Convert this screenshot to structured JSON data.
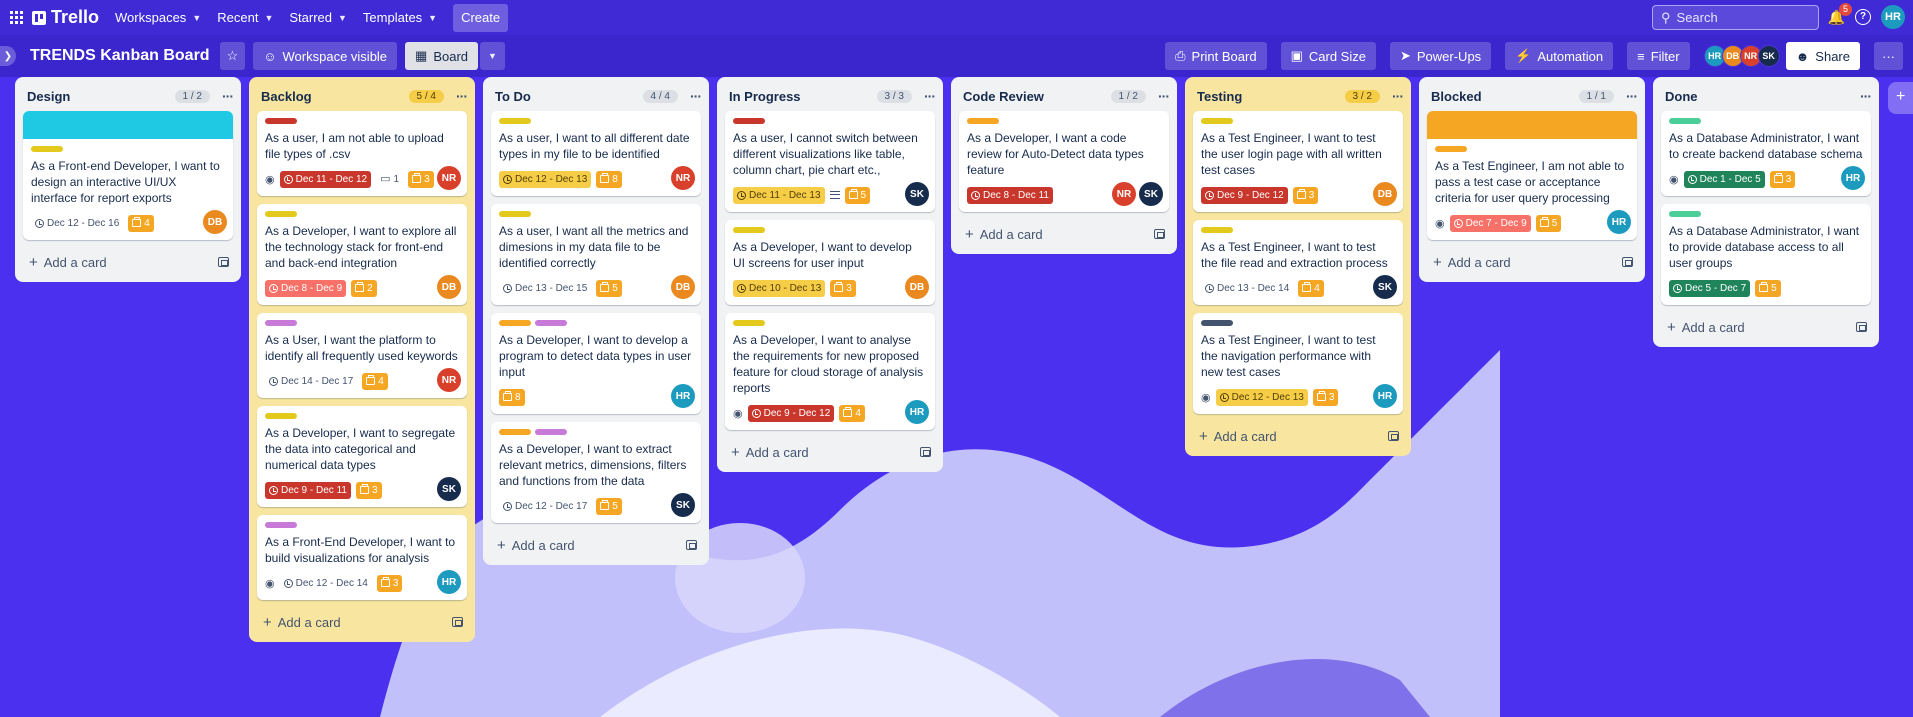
{
  "topbar": {
    "app_name": "Trello",
    "menus": [
      "Workspaces",
      "Recent",
      "Starred",
      "Templates"
    ],
    "create_label": "Create",
    "search_placeholder": "Search",
    "notifications_count": "5",
    "user_initials": "HR"
  },
  "board": {
    "title": "TRENDS Kanban Board",
    "visibility_label": "Workspace visible",
    "view_label": "Board",
    "print_label": "Print Board",
    "card_size_label": "Card Size",
    "powerups_label": "Power-Ups",
    "automation_label": "Automation",
    "filter_label": "Filter",
    "share_label": "Share",
    "members": [
      {
        "initials": "HR",
        "color": "#1d9bbf"
      },
      {
        "initials": "DB",
        "color": "#e9891f"
      },
      {
        "initials": "NR",
        "color": "#d9402b"
      },
      {
        "initials": "SK",
        "color": "#172b4d"
      }
    ]
  },
  "add_card_label": "Add a card",
  "lists": [
    {
      "title": "Design",
      "count": "1 / 2",
      "cards": [
        {
          "title": "As a Front-end Developer, I want to design an interactive UI/UX interface for report exports",
          "date": "Dec 12 - Dec 16",
          "points": "4",
          "member": "DB"
        }
      ]
    },
    {
      "title": "Backlog",
      "count": "5 / 4",
      "cards": [
        {
          "title": "As a user, I am not able to upload file types of .csv",
          "date": "Dec 11 - Dec 12",
          "comments": "1",
          "points": "3",
          "member": "NR"
        },
        {
          "title": "As a Developer, I want to explore all the technology stack for front-end and back-end integration",
          "date": "Dec 8 - Dec 9",
          "points": "2",
          "member": "DB"
        },
        {
          "title": "As a User, I want the platform to identify all frequently used keywords",
          "date": "Dec 14 - Dec 17",
          "points": "4",
          "member": "NR"
        },
        {
          "title": "As a Developer, I want to segregate the data into categorical and numerical data types",
          "date": "Dec 9 - Dec 11",
          "points": "3",
          "member": "SK"
        },
        {
          "title": "As a Front-End Developer, I want to build visualizations for analysis",
          "date": "Dec 12 - Dec 14",
          "points": "3",
          "member": "HR"
        }
      ]
    },
    {
      "title": "To Do",
      "count": "4 / 4",
      "cards": [
        {
          "title": "As a user, I want to all different date types in my file to be identified",
          "date": "Dec 12 - Dec 13",
          "points": "8",
          "member": "NR"
        },
        {
          "title": "As a user, I want all the metrics and dimesions in my data file to be identified correctly",
          "date": "Dec 13 - Dec 15",
          "points": "5",
          "member": "DB"
        },
        {
          "title": "As a Developer, I want to develop a program to detect data types in user input",
          "points": "8",
          "member": "HR"
        },
        {
          "title": "As a Developer, I want to extract relevant metrics, dimensions, filters and functions from the data",
          "date": "Dec 12 - Dec 17",
          "points": "5",
          "member": "SK"
        }
      ]
    },
    {
      "title": "In Progress",
      "count": "3 / 3",
      "cards": [
        {
          "title": "As a user, I cannot switch between different visualizations like table, column chart, pie chart etc.,",
          "date": "Dec 11 - Dec 13",
          "points": "5",
          "member": "SK"
        },
        {
          "title": "As a Developer, I want to develop UI screens for user input",
          "date": "Dec 10 - Dec 13",
          "points": "3",
          "member": "DB"
        },
        {
          "title": "As a Developer, I want to analyse the requirements for new proposed feature for cloud storage of analysis reports",
          "date": "Dec 9 - Dec 12",
          "points": "4",
          "member": "HR"
        }
      ]
    },
    {
      "title": "Code Review",
      "count": "1 / 2",
      "cards": [
        {
          "title": "As a Developer, I want a code review for Auto-Detect data types feature",
          "date": "Dec 8 - Dec 11",
          "members": [
            "NR",
            "SK"
          ]
        }
      ]
    },
    {
      "title": "Testing",
      "count": "3 / 2",
      "cards": [
        {
          "title": "As a Test Engineer, I want to test the user login page with all written test cases",
          "date": "Dec 9 - Dec 12",
          "points": "3",
          "member": "DB"
        },
        {
          "title": "As a Test Engineer, I want to test the file read and extraction process",
          "date": "Dec 13 - Dec 14",
          "points": "4",
          "member": "SK"
        },
        {
          "title": "As a Test Engineer, I want to test the navigation performance with new test cases",
          "date": "Dec 12 - Dec 13",
          "points": "3",
          "member": "HR"
        }
      ]
    },
    {
      "title": "Blocked",
      "count": "1 / 1",
      "cards": [
        {
          "title": "As a Test Engineer, I am not able to pass a test case or acceptance criteria for user query processing",
          "date": "Dec 7 - Dec 9",
          "points": "5",
          "member": "HR"
        }
      ]
    },
    {
      "title": "Done",
      "count": "",
      "cards": [
        {
          "title": "As a Database Administrator, I want to create backend database schema",
          "date": "Dec 1 - Dec 5",
          "points": "3",
          "member": "HR"
        },
        {
          "title": "As a Database Administrator, I want to provide database access to all user groups",
          "date": "Dec 5 - Dec 7",
          "points": "5"
        }
      ]
    }
  ]
}
